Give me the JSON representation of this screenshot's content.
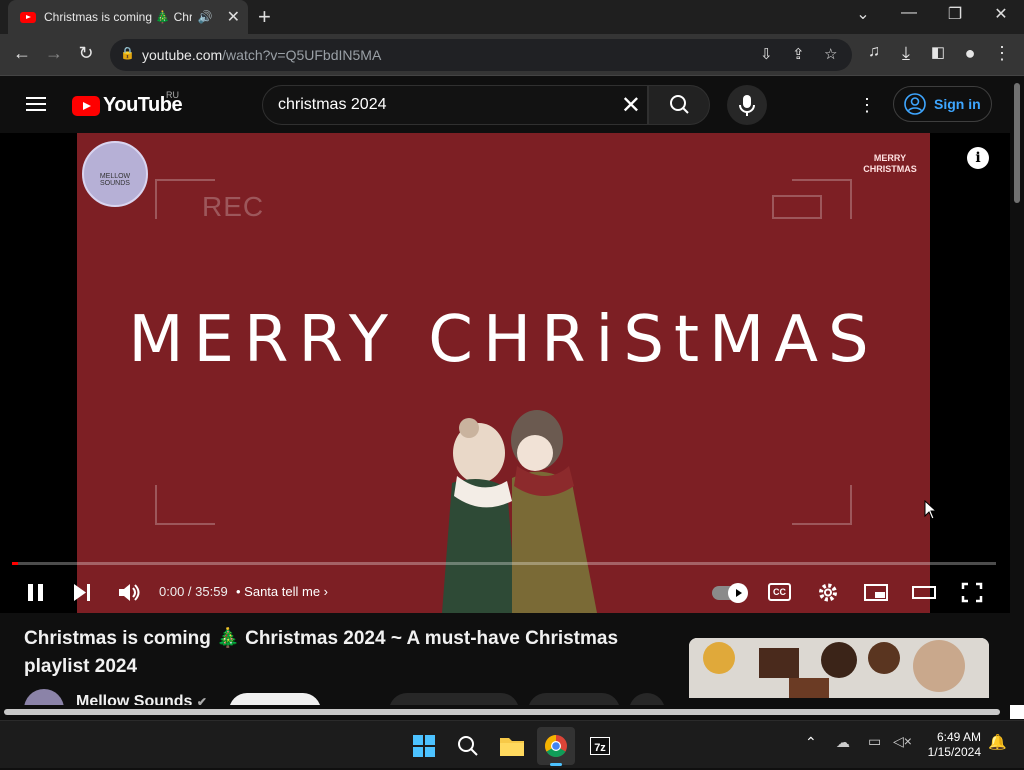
{
  "browser": {
    "tab": {
      "title": "Christmas is coming 🎄 Chr"
    },
    "address": {
      "host": "youtube.com",
      "path": "/watch?v=Q5UFbdIN5MA"
    }
  },
  "youtube": {
    "region": "RU",
    "search": {
      "query": "christmas 2024"
    },
    "signin_label": "Sign in"
  },
  "player": {
    "overlay_text": "MERRY CHRiStMAS",
    "rec_label": "REC",
    "channel_watermark": "MELLOW SOUNDS",
    "badge_text": "MERRY CHRISTMAS",
    "time_current": "0:00",
    "time_separator": " / ",
    "time_total": "35:59",
    "chapter": "Santa tell me",
    "progress": 0.006,
    "cc_label": "CC"
  },
  "video": {
    "title": "Christmas is coming 🎄 Christmas 2024 ~ A must-have Christmas playlist 2024",
    "channel": "Mellow Sounds"
  },
  "taskbar": {
    "time": "6:49 AM",
    "date": "1/15/2024"
  },
  "colors": {
    "brand_red": "#ff0000",
    "video_bg": "#7d1f24",
    "link_blue": "#3ea6ff"
  }
}
